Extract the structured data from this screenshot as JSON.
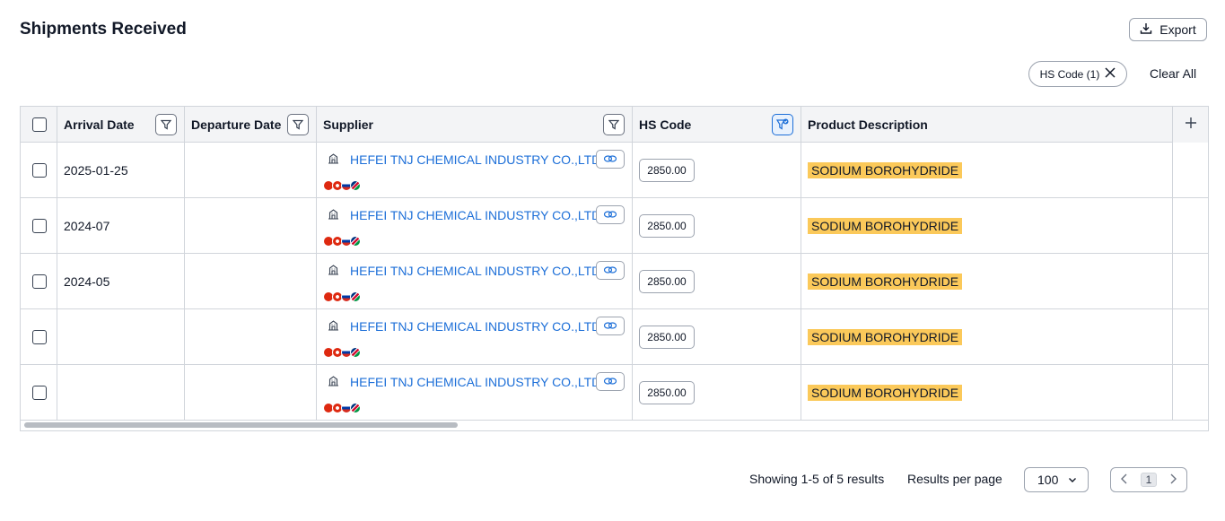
{
  "page": {
    "title": "Shipments Received"
  },
  "toolbar": {
    "export_label": "Export"
  },
  "filters": {
    "chip_label": "HS Code (1)",
    "clear_all_label": "Clear All"
  },
  "table": {
    "columns": [
      {
        "label": "Arrival Date"
      },
      {
        "label": "Departure Date"
      },
      {
        "label": "Supplier"
      },
      {
        "label": "HS Code"
      },
      {
        "label": "Product Description"
      }
    ],
    "rows": [
      {
        "arrival_date": "2025-01-25",
        "departure_date": "",
        "supplier": "HEFEI TNJ CHEMICAL INDUSTRY CO.,LTD.",
        "hs_code": "2850.00",
        "product_description": "SODIUM BOROHYDRIDE"
      },
      {
        "arrival_date": "2024-07",
        "departure_date": "",
        "supplier": "HEFEI TNJ CHEMICAL INDUSTRY CO.,LTD.",
        "hs_code": "2850.00",
        "product_description": "SODIUM BOROHYDRIDE"
      },
      {
        "arrival_date": "2024-05",
        "departure_date": "",
        "supplier": "HEFEI TNJ CHEMICAL INDUSTRY CO.,LTD.",
        "hs_code": "2850.00",
        "product_description": "SODIUM BOROHYDRIDE"
      },
      {
        "arrival_date": "",
        "departure_date": "",
        "supplier": "HEFEI TNJ CHEMICAL INDUSTRY CO.,LTD.",
        "hs_code": "2850.00",
        "product_description": "SODIUM BOROHYDRIDE"
      },
      {
        "arrival_date": "",
        "departure_date": "",
        "supplier": "HEFEI TNJ CHEMICAL INDUSTRY CO.,LTD.",
        "hs_code": "2850.00",
        "product_description": "SODIUM BOROHYDRIDE"
      }
    ],
    "supplier_flag_icons": [
      "china-flag-icon",
      "hong-kong-flag-icon",
      "russia-flag-icon",
      "namibia-flag-icon"
    ]
  },
  "footer": {
    "showing_text": "Showing 1-5 of 5 results",
    "per_page_label": "Results per page",
    "per_page_value": "100",
    "current_page": "1"
  },
  "colors": {
    "link": "#1d6fd8",
    "highlight": "#fbc95a",
    "header_bg": "#f3f4f6",
    "border": "#d1d5db"
  }
}
